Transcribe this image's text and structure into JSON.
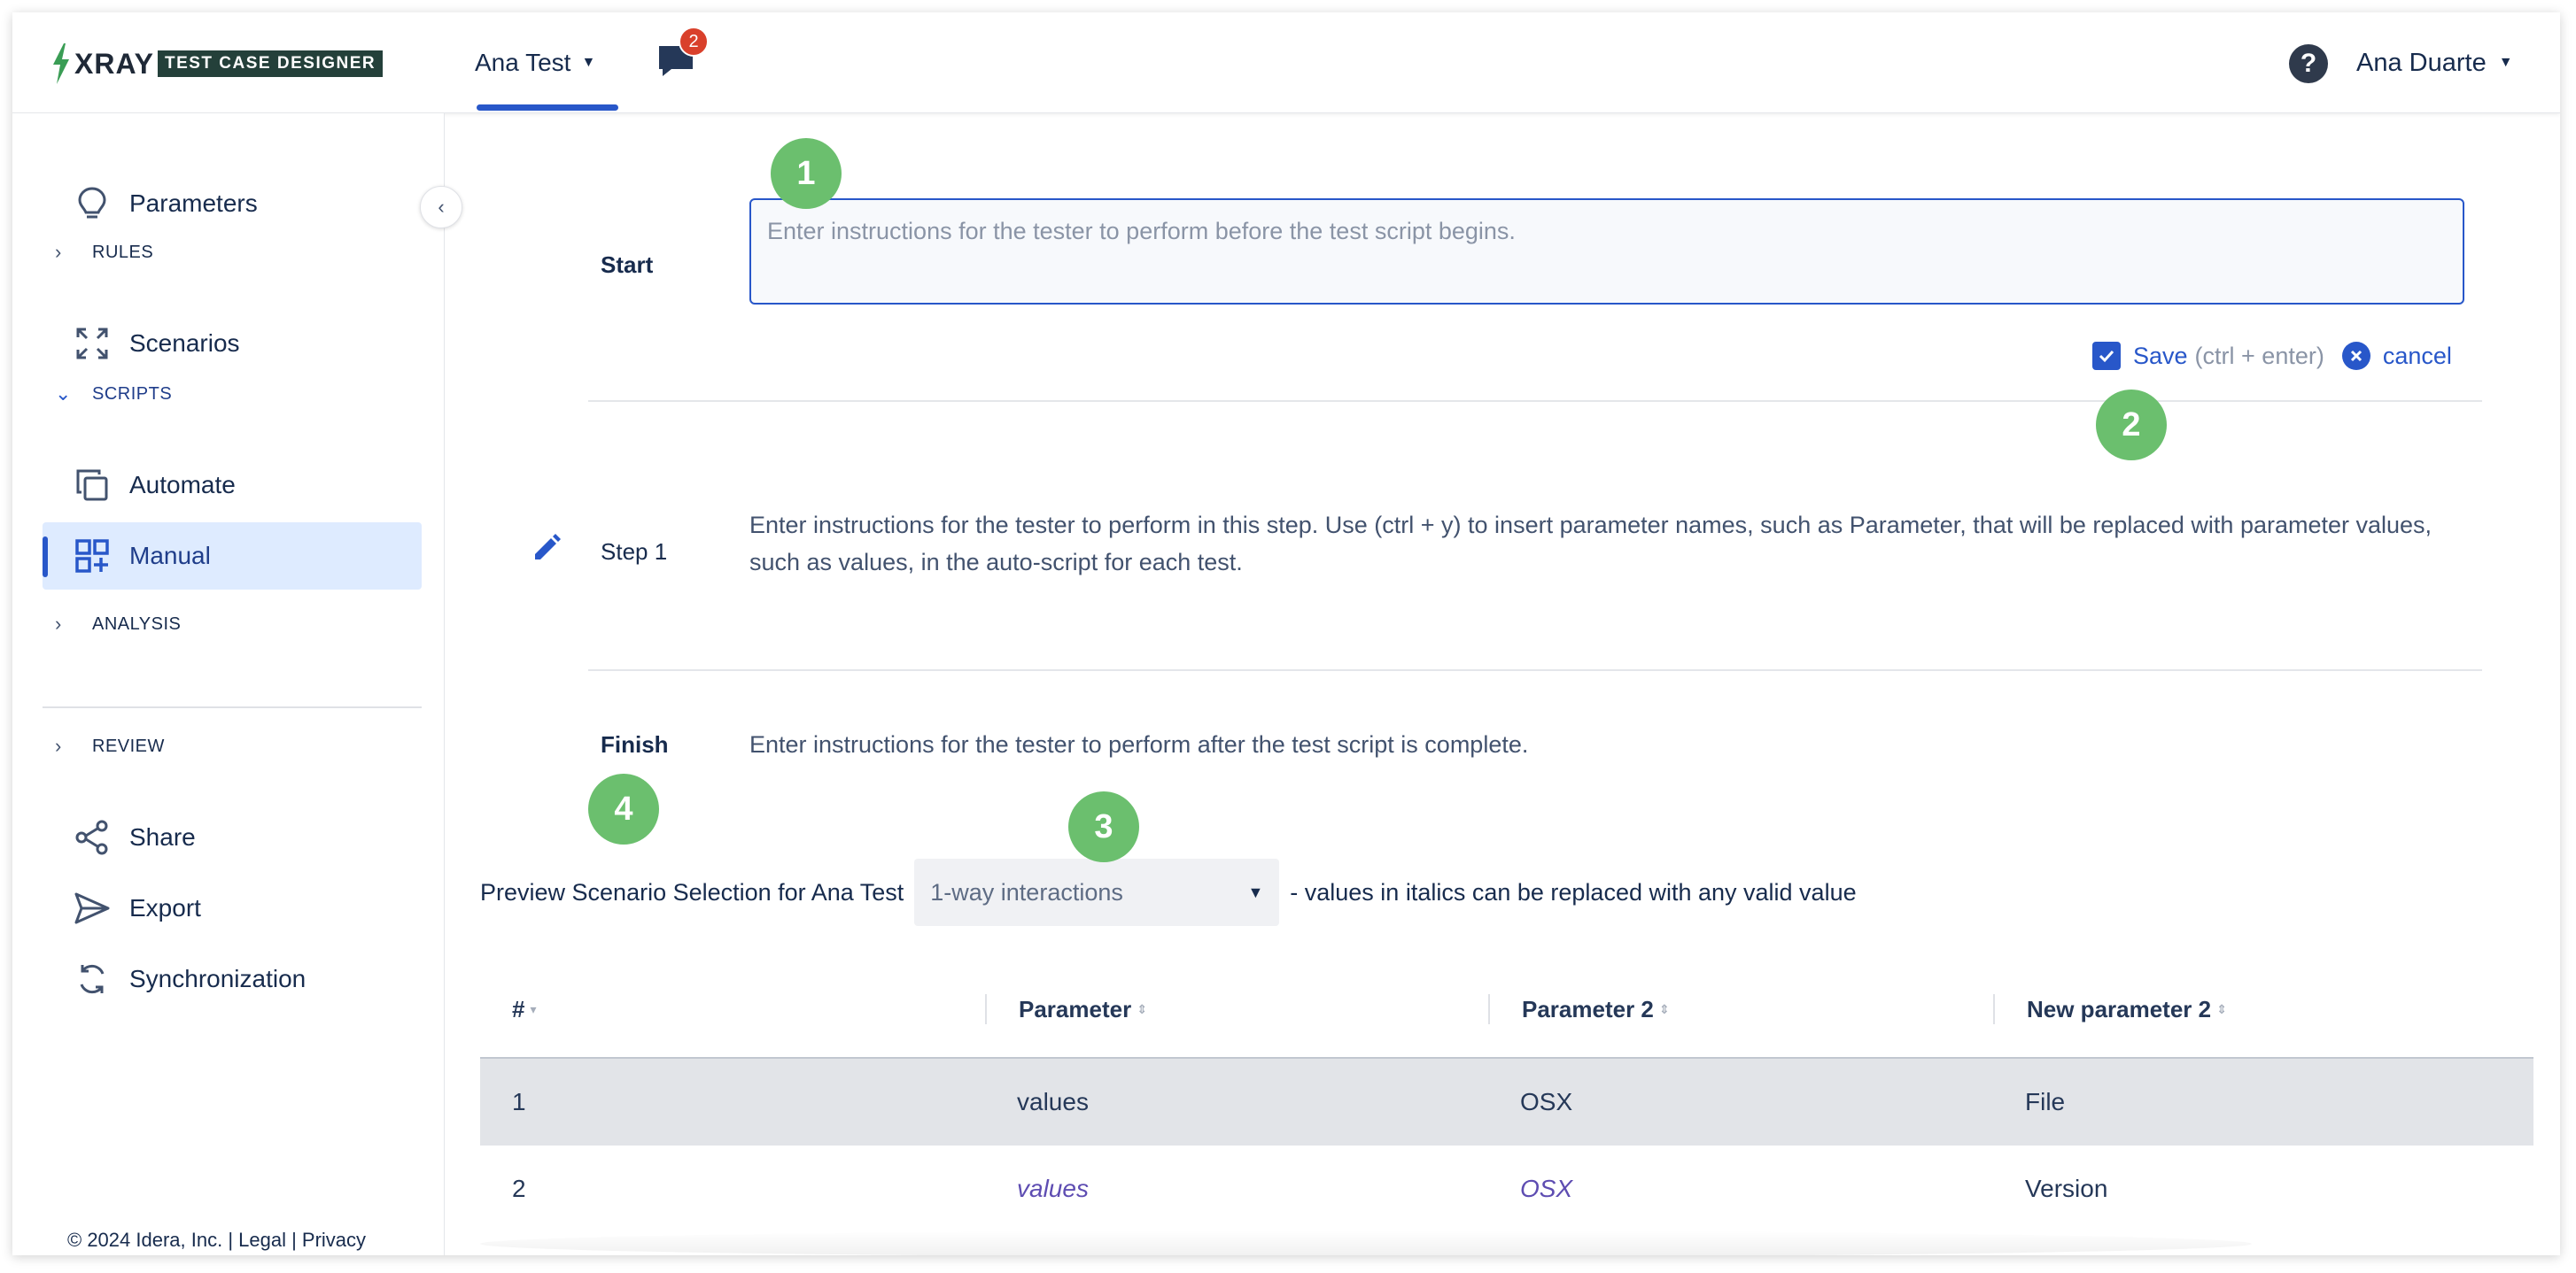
{
  "header": {
    "logo_text": "XRAY",
    "logo_badge": "TEST CASE DESIGNER",
    "project_name": "Ana Test",
    "notification_count": "2",
    "help_label": "?",
    "user_name": "Ana Duarte"
  },
  "sidebar": {
    "items": [
      {
        "label": "Parameters",
        "icon": "lightbulb-icon"
      },
      {
        "label": "RULES",
        "type": "section",
        "expanded": false
      },
      {
        "label": "Scenarios",
        "icon": "expand-arrows-icon"
      },
      {
        "label": "SCRIPTS",
        "type": "section",
        "expanded": true
      },
      {
        "label": "Automate",
        "icon": "copy-icon"
      },
      {
        "label": "Manual",
        "icon": "grid-plus-icon",
        "active": true
      },
      {
        "label": "ANALYSIS",
        "type": "section",
        "expanded": false
      },
      {
        "label": "REVIEW",
        "type": "section",
        "expanded": false
      },
      {
        "label": "Share",
        "icon": "share-icon"
      },
      {
        "label": "Export",
        "icon": "send-icon"
      },
      {
        "label": "Synchronization",
        "icon": "sync-icon"
      }
    ],
    "footer": "© 2024 Idera, Inc. | Legal | Privacy"
  },
  "script": {
    "badges": [
      "1",
      "2",
      "3",
      "4"
    ],
    "start_label": "Start",
    "start_placeholder": "Enter instructions for the tester to perform before the test script begins.",
    "start_value": "",
    "save_label": "Save",
    "save_hint": "(ctrl + enter)",
    "cancel_label": "cancel",
    "step_label": "Step 1",
    "step_text": "Enter instructions for the tester to perform in this step. Use (ctrl + y) to insert parameter names, such as Parameter, that will be replaced with parameter values, such as values, in the auto-script for each test.",
    "finish_label": "Finish",
    "finish_text": "Enter instructions for the tester to perform after the test script is complete."
  },
  "preview": {
    "prefix": "Preview Scenario Selection for Ana Test",
    "selected": "1-way interactions",
    "suffix": "- values in italics can be replaced with any valid value"
  },
  "table": {
    "columns": [
      "#",
      "Parameter",
      "Parameter 2",
      "New parameter 2"
    ],
    "rows": [
      {
        "num": "1",
        "param": "values",
        "param2": "OSX",
        "newparam2": "File",
        "italic": false
      },
      {
        "num": "2",
        "param": "values",
        "param2": "OSX",
        "newparam2": "Version",
        "italic": true
      }
    ]
  },
  "colors": {
    "accent": "#2857c9",
    "badge_green": "#6bbf6e",
    "notification_red": "#d9402b",
    "active_bg": "#deebff"
  }
}
